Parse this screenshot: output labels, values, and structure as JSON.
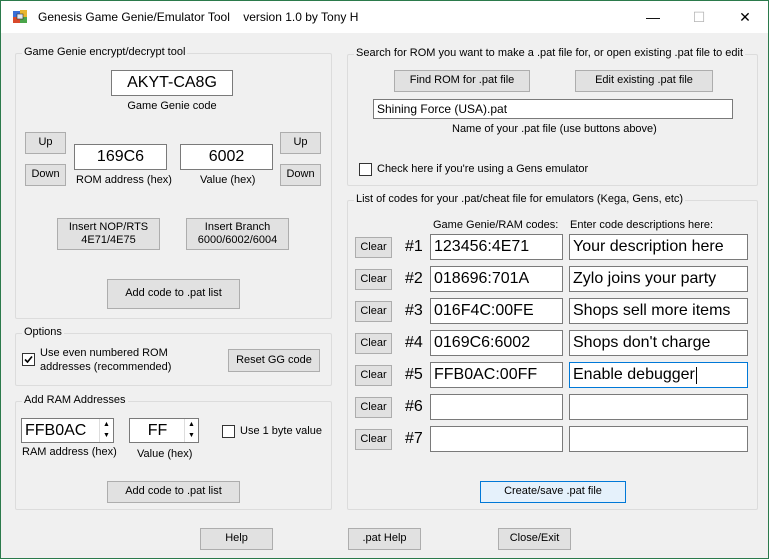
{
  "window": {
    "title": "Genesis Game Genie/Emulator Tool    version 1.0 by Tony H",
    "minimize": "—",
    "maximize": "☐",
    "close": "✕"
  },
  "gg": {
    "group_label": "Game Genie encrypt/decrypt tool",
    "code": "AKYT-CA8G",
    "code_label": "Game Genie code",
    "up": "Up",
    "down": "Down",
    "rom_address": "169C6",
    "rom_address_label": "ROM address (hex)",
    "value": "6002",
    "value_label": "Value (hex)",
    "insert_nop_line1": "Insert NOP/RTS",
    "insert_nop_line2": "4E71/4E75",
    "insert_branch_line1": "Insert Branch",
    "insert_branch_line2": "6000/6002/6004",
    "add_code": "Add code to .pat list"
  },
  "options": {
    "group_label": "Options",
    "even_rom_line1": "Use even numbered ROM",
    "even_rom_line2": "addresses (recommended)",
    "even_rom_checked": true,
    "reset_gg": "Reset GG code"
  },
  "ram": {
    "group_label": "Add RAM Addresses",
    "address": "FFB0AC",
    "address_label": "RAM address (hex)",
    "value": "FF",
    "value_label": "Value (hex)",
    "one_byte_label": "Use 1 byte value",
    "one_byte_checked": false,
    "add_code": "Add code to .pat list"
  },
  "rom": {
    "group_label": "Search for ROM you want to make a .pat file for, or open existing .pat file to edit",
    "find_rom": "Find ROM for .pat file",
    "edit_existing": "Edit existing .pat file",
    "pat_name": "Shining Force (USA).pat",
    "pat_name_label": "Name of your .pat file (use buttons above)",
    "gens_label": "Check here if you're using a Gens emulator",
    "gens_checked": false
  },
  "codes": {
    "group_label": "List of codes for your .pat/cheat file for emulators (Kega, Gens, etc)",
    "col_codes": "Game Genie/RAM codes:",
    "col_desc": "Enter code descriptions here:",
    "clear": "Clear",
    "rows": [
      {
        "num": "#1",
        "code": "123456:4E71",
        "desc": "Your description here"
      },
      {
        "num": "#2",
        "code": "018696:701A",
        "desc": "Zylo joins your party"
      },
      {
        "num": "#3",
        "code": "016F4C:00FE",
        "desc": "Shops sell more items"
      },
      {
        "num": "#4",
        "code": "0169C6:6002",
        "desc": "Shops don't charge"
      },
      {
        "num": "#5",
        "code": "FFB0AC:00FF",
        "desc": "Enable debugger"
      },
      {
        "num": "#6",
        "code": "",
        "desc": ""
      },
      {
        "num": "#7",
        "code": "",
        "desc": ""
      }
    ],
    "create_save": "Create/save .pat file"
  },
  "footer": {
    "help": "Help",
    "pat_help": ".pat Help",
    "close_exit": "Close/Exit"
  }
}
